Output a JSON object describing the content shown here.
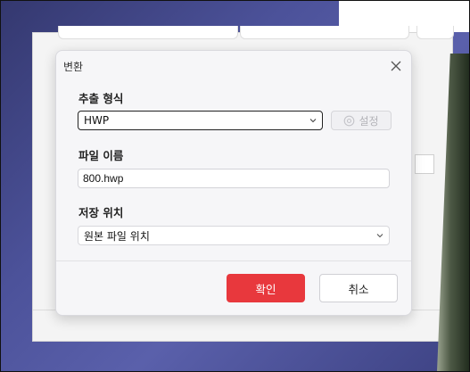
{
  "dialog": {
    "title": "변환",
    "close_icon": "close-icon",
    "format": {
      "label": "추출 형식",
      "selected": "HWP",
      "settings_label": "설정",
      "settings_icon": "gear-icon"
    },
    "filename": {
      "label": "파일 이름",
      "value": "800.hwp"
    },
    "location": {
      "label": "저장 위치",
      "selected": "원본 파일 위치"
    },
    "ok_label": "확인",
    "cancel_label": "취소"
  },
  "colors": {
    "ok_button": "#e8383d",
    "dialog_bg": "#f6f6f8",
    "disabled_text": "#b3b3b8"
  }
}
